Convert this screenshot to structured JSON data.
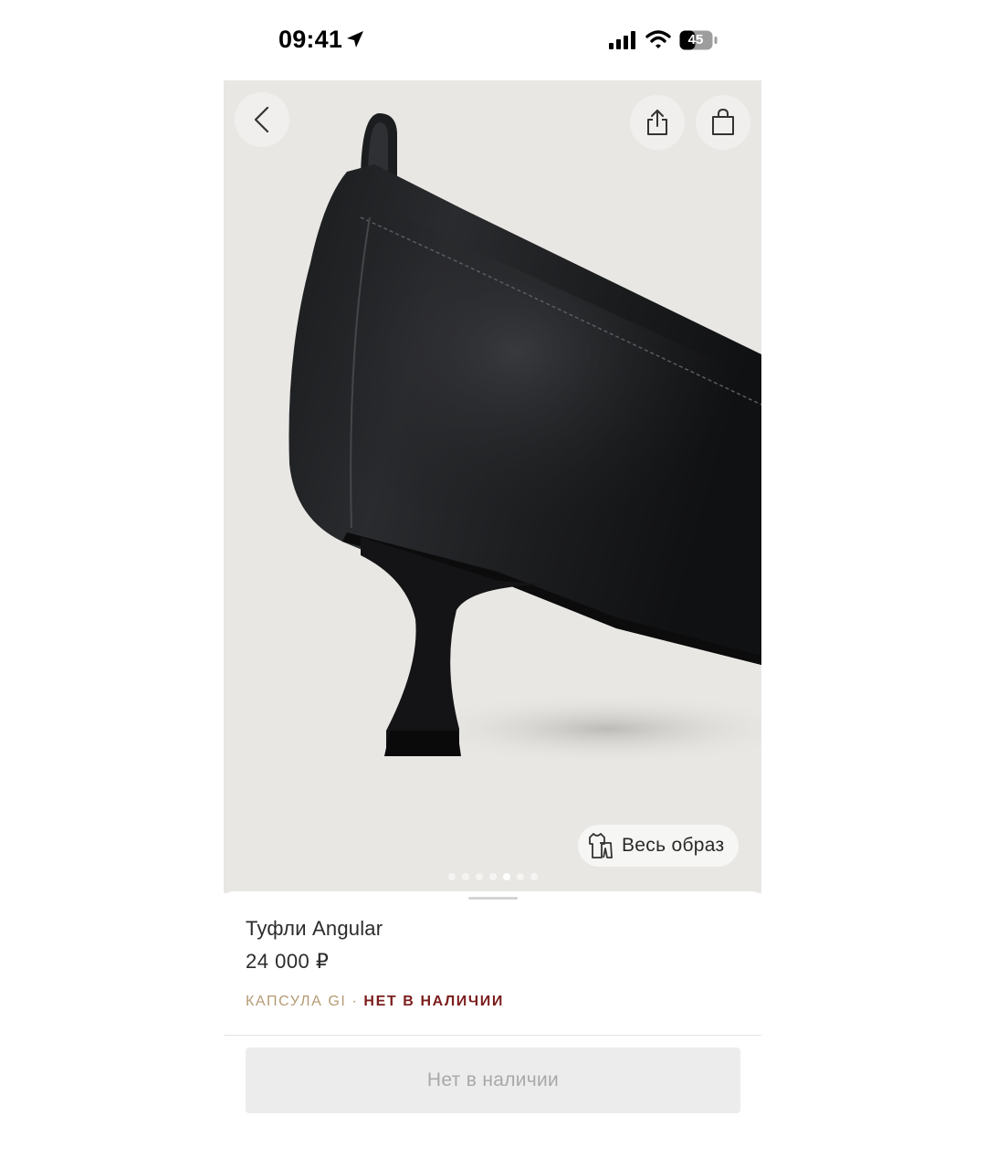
{
  "status_bar": {
    "time": "09:41",
    "battery": "45",
    "icons": [
      "location-arrow-icon",
      "cellular-signal-icon",
      "wifi-icon",
      "battery-icon"
    ]
  },
  "gallery": {
    "total_images": 7,
    "active_index": 4,
    "look_button_label": "Весь образ",
    "icons": [
      "back-chevron-icon",
      "share-icon",
      "shopping-bag-icon",
      "outfit-icon"
    ]
  },
  "product": {
    "title": "Туфли Angular",
    "price": "24 000 ₽",
    "capsule": "КАПСУЛА GI",
    "separator": "·",
    "stock_status": "НЕТ В НАЛИЧИИ",
    "buy_button_label": "Нет в наличии"
  },
  "colors": {
    "capsule_gold": "#b59a73",
    "stock_red": "#7c1d1d",
    "disabled_button_bg": "#ececec",
    "image_background": "#e8e7e4"
  }
}
